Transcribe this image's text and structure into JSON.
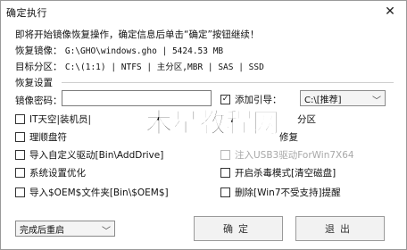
{
  "window": {
    "title": "确定执行",
    "close_glyph": "✕"
  },
  "info": {
    "instruction": "即将开始镜像恢复操作，确定信息后单击“确定”按钮继续！",
    "image_file_label": "恢复镜像：",
    "image_file_value": "G:\\GHO\\windows.gho | 5424.53 MB",
    "target_label": "目标分区：",
    "target_value": "C:\\(1:1) | NTFS | 主分区,MBR | SAS | SSD"
  },
  "settings": {
    "group_label": "恢复设置",
    "password_label": "镜像密码：",
    "password_value": "",
    "boot_checkbox_label": "添加引导：",
    "boot_checked": true,
    "boot_select_value": "C:\\[推荐]"
  },
  "options": [
    {
      "label": "IT天空|装机员|",
      "checked": false,
      "disabled": false
    },
    {
      "label": "分区",
      "checked": false,
      "disabled": false
    },
    {
      "label": "理顺盘符",
      "checked": false,
      "disabled": false
    },
    {
      "label": "修复",
      "checked": false,
      "disabled": false
    },
    {
      "label": "导入自定义驱动[Bin\\AddDrive]",
      "checked": false,
      "disabled": false
    },
    {
      "label": "注入USB3驱动ForWin7X64",
      "checked": false,
      "disabled": true
    },
    {
      "label": "系统设置优化",
      "checked": false,
      "disabled": false
    },
    {
      "label": "开启杀毒模式[清空磁盘]",
      "checked": false,
      "disabled": false
    },
    {
      "label": "导入$OEM$文件夹[Bin\\$OEM$]",
      "checked": false,
      "disabled": false
    },
    {
      "label": "删除[Win7不受支持]提醒",
      "checked": false,
      "disabled": false
    }
  ],
  "footer": {
    "after_select_value": "完成后重启",
    "ok_label": "确定",
    "exit_label": "退出"
  },
  "watermark": {
    "text": "木星教程网",
    "color": "#111111"
  },
  "colors": {
    "accent_check": "#1a1a1a",
    "disabled_text": "#a8a8a8"
  }
}
